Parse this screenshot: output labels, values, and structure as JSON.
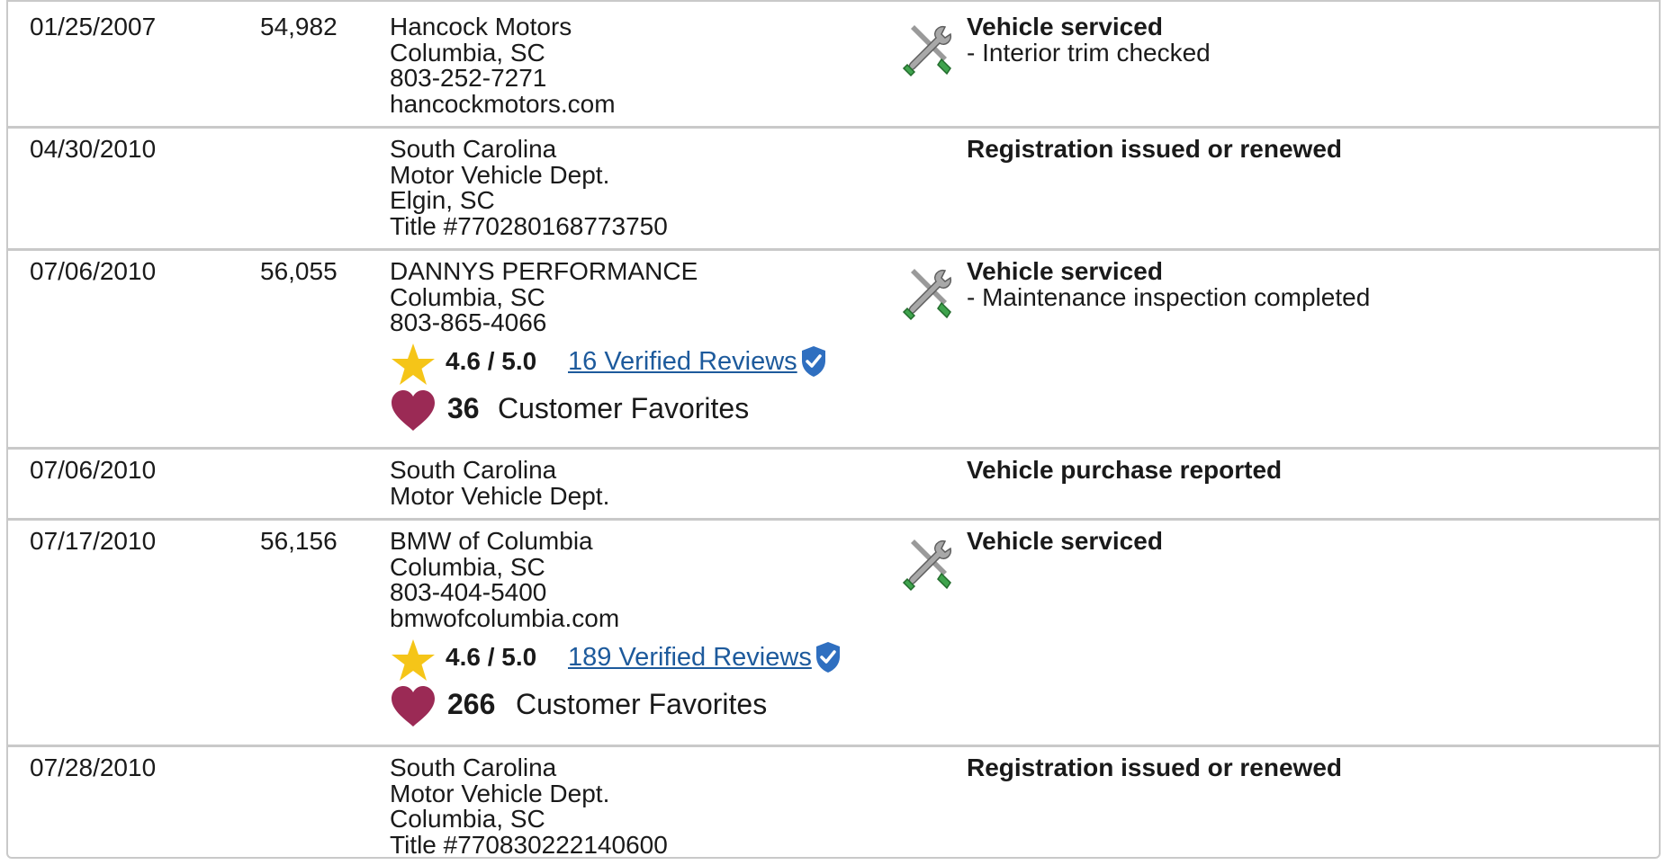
{
  "records": [
    {
      "date": "01/25/2007",
      "mileage": "54,982",
      "source_lines": [
        "Hancock Motors",
        "Columbia, SC",
        "803-252-7271",
        "hancockmotors.com"
      ],
      "icon": "service-tools-icon",
      "event": "Vehicle serviced",
      "detail": "- Interior trim checked"
    },
    {
      "date": "04/30/2010",
      "mileage": "",
      "source_lines": [
        "South Carolina",
        "Motor Vehicle Dept.",
        "Elgin, SC",
        "Title #770280168773750"
      ],
      "icon": "",
      "event": "Registration issued or renewed",
      "detail": ""
    },
    {
      "date": "07/06/2010",
      "mileage": "56,055",
      "source_lines": [
        "DANNYS PERFORMANCE",
        "Columbia, SC",
        "803-865-4066"
      ],
      "rating": "4.6 / 5.0",
      "reviews": "16 Verified Reviews",
      "favorites_count": "36",
      "favorites_label": "Customer Favorites",
      "icon": "service-tools-icon",
      "event": "Vehicle serviced",
      "detail": "- Maintenance inspection completed"
    },
    {
      "date": "07/06/2010",
      "mileage": "",
      "source_lines": [
        "South Carolina",
        "Motor Vehicle Dept."
      ],
      "icon": "",
      "event": "Vehicle purchase reported",
      "detail": ""
    },
    {
      "date": "07/17/2010",
      "mileage": "56,156",
      "source_lines": [
        "BMW of Columbia",
        "Columbia, SC",
        "803-404-5400",
        "bmwofcolumbia.com"
      ],
      "rating": "4.6 / 5.0",
      "reviews": "189 Verified Reviews",
      "favorites_count": "266",
      "favorites_label": "Customer Favorites",
      "icon": "service-tools-icon",
      "event": "Vehicle serviced",
      "detail": ""
    },
    {
      "date": "07/28/2010",
      "mileage": "",
      "source_lines": [
        "South Carolina",
        "Motor Vehicle Dept.",
        "Columbia, SC",
        "Title #770830222140600"
      ],
      "icon": "",
      "event": "Registration issued or renewed",
      "detail": ""
    }
  ],
  "colors": {
    "border": "#c9c9c9",
    "link": "#1d5a9c",
    "star": "#f5c518",
    "heart": "#9b2a55",
    "shield": "#2f6fc0",
    "tool_green": "#3fa34d"
  }
}
